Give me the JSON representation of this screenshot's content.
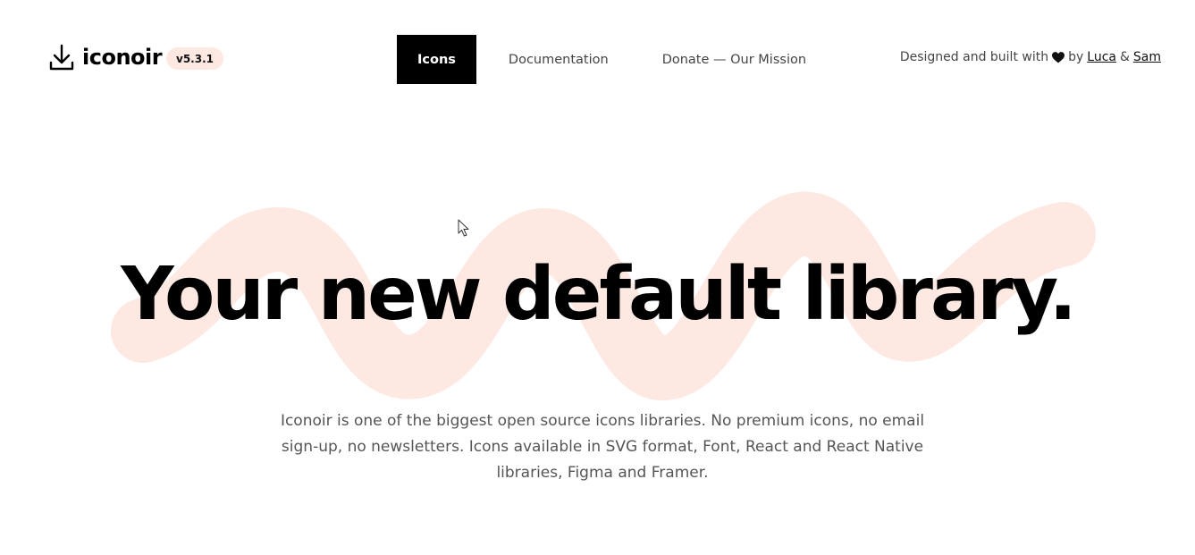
{
  "header": {
    "logo_text": "iconoir",
    "version": "v5.3.1",
    "nav": [
      {
        "label": "Icons",
        "active": true
      },
      {
        "label": "Documentation",
        "active": false
      },
      {
        "label": "Donate — Our Mission",
        "active": false
      }
    ],
    "credit": {
      "prefix": "Designed and built with",
      "by": "by",
      "author1": "Luca",
      "amp": "&",
      "author2": "Sam"
    }
  },
  "hero": {
    "title": "Your new default library.",
    "description": "Iconoir is one of the biggest open source icons libraries. No premium icons, no email sign-up, no newsletters. Icons available in SVG format, Font, React and React Native libraries, Figma and Framer."
  },
  "colors": {
    "accent": "#fde8e2",
    "text": "#000000",
    "muted": "#555555"
  },
  "icons": {
    "logo": "download-icon",
    "heart": "heart-icon",
    "cursor": "mouse-pointer-icon"
  }
}
